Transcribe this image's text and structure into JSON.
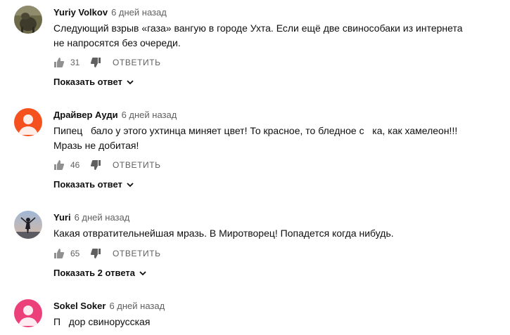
{
  "comments": [
    {
      "author": "Yuriy Volkov",
      "time": "6 дней назад",
      "lines": [
        "Следующий взрыв «газа» вангую в городе Ухта. Если ещё две свинособаки из интернета",
        "не напросятся без очереди."
      ],
      "likes": "31",
      "reply_label": "ОТВЕТИТЬ",
      "show_replies": "Показать ответ",
      "avatar": "photo-avatar-icon"
    },
    {
      "author": "Драйвер Ауди",
      "time": "6 дней назад",
      "lines": [
        "Пипец   бало у этого ухтинца миняет цвет! То красное, то бледное с   ка, как хамелеон!!!",
        "Мразь не добитая!"
      ],
      "likes": "46",
      "reply_label": "ОТВЕТИТЬ",
      "show_replies": "Показать ответ",
      "avatar": "default-user-avatar-icon",
      "avatar_color": "#f4511e"
    },
    {
      "author": "Yuri",
      "time": "6 дней назад",
      "lines": [
        "Какая отвратительнейшая мразь. В Миротворец! Попадется когда нибудь."
      ],
      "likes": "65",
      "reply_label": "ОТВЕТИТЬ",
      "show_replies": "Показать 2 ответа",
      "avatar": "photo-avatar-icon"
    },
    {
      "author": "Sokel Soker",
      "time": "6 дней назад",
      "lines": [
        "П   дор свинорусская"
      ],
      "avatar": "default-user-avatar-icon",
      "avatar_color": "#ec407a"
    }
  ]
}
